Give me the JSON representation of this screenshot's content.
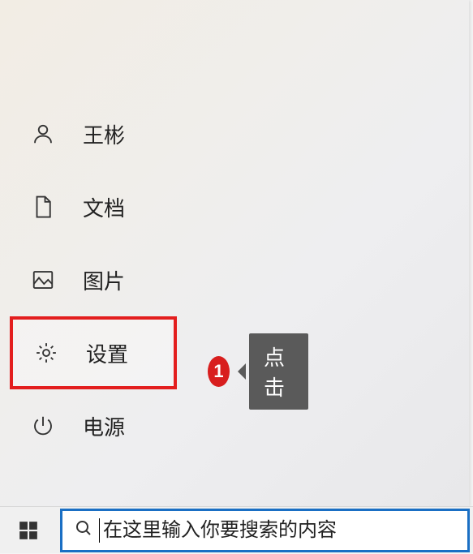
{
  "menu": {
    "items": [
      {
        "icon": "user-icon",
        "label": "王彬"
      },
      {
        "icon": "document-icon",
        "label": "文档"
      },
      {
        "icon": "pictures-icon",
        "label": "图片"
      },
      {
        "icon": "gear-icon",
        "label": "设置"
      },
      {
        "icon": "power-icon",
        "label": "电源"
      }
    ]
  },
  "annotation": {
    "number": "1",
    "text": "点击"
  },
  "search": {
    "placeholder": "在这里输入你要搜索的内容"
  }
}
